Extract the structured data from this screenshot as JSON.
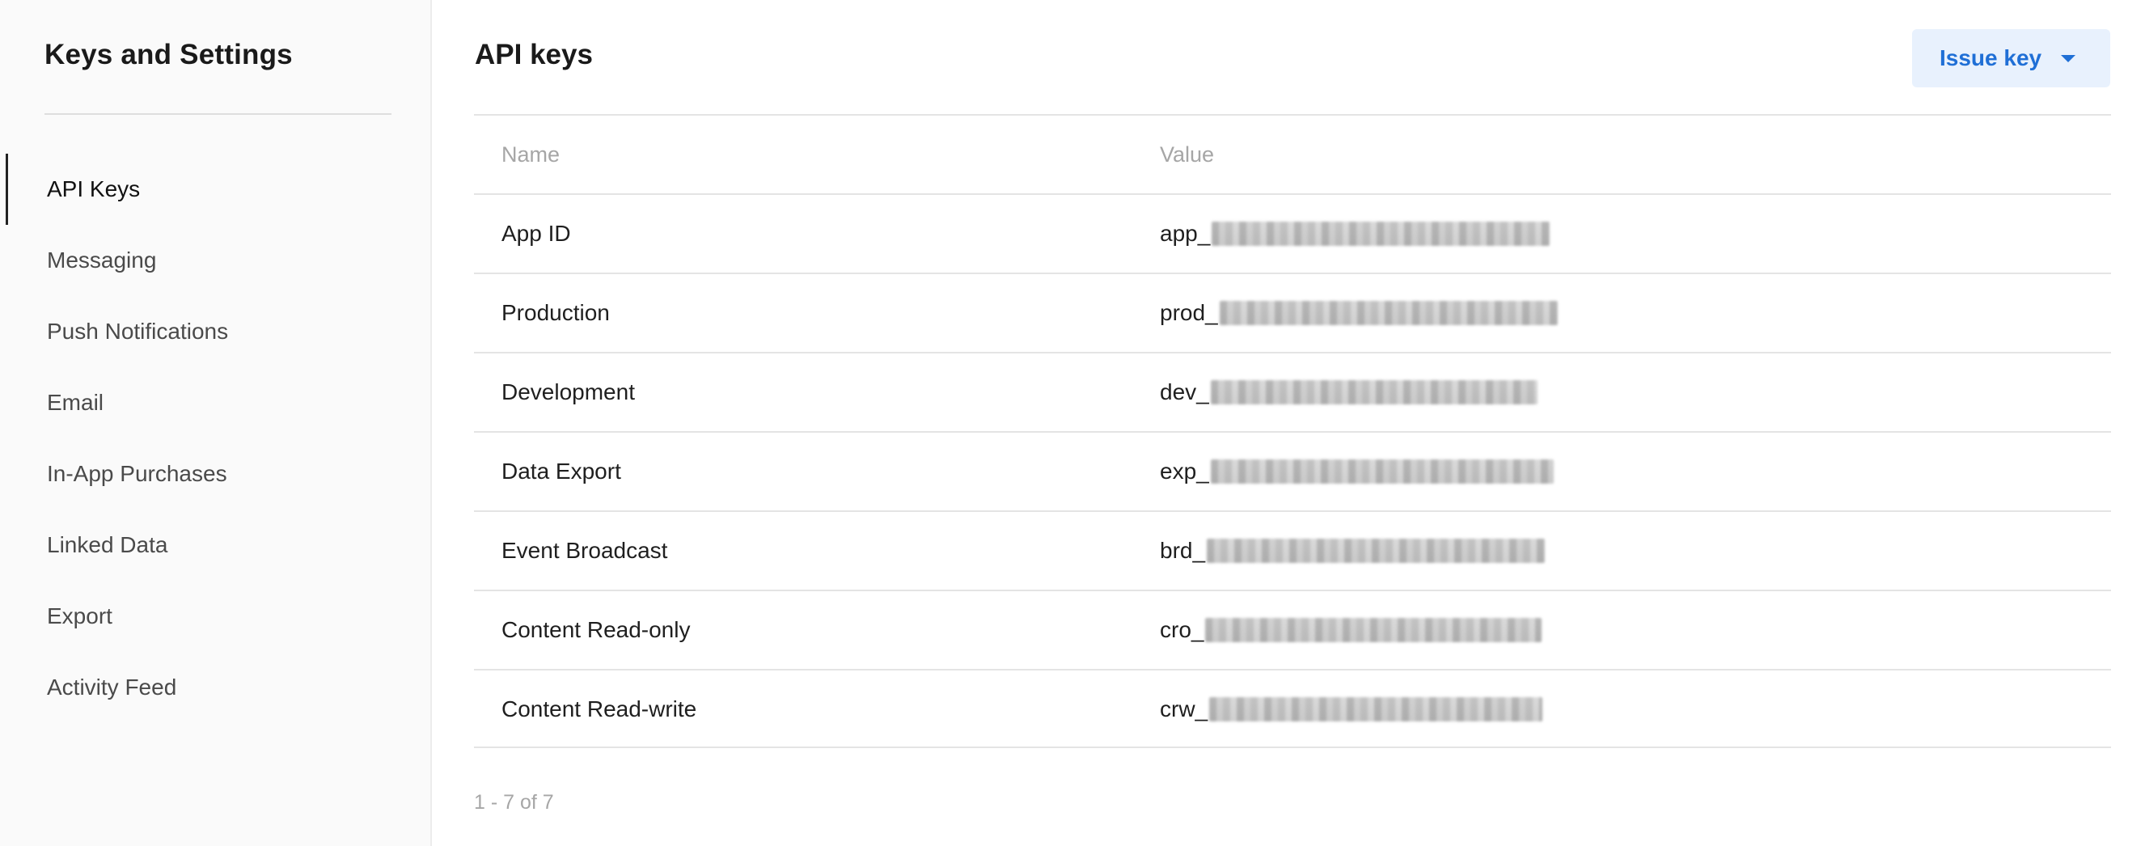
{
  "sidebar": {
    "title": "Keys and Settings",
    "items": [
      {
        "label": "API Keys",
        "active": true
      },
      {
        "label": "Messaging",
        "active": false
      },
      {
        "label": "Push Notifications",
        "active": false
      },
      {
        "label": "Email",
        "active": false
      },
      {
        "label": "In-App Purchases",
        "active": false
      },
      {
        "label": "Linked Data",
        "active": false
      },
      {
        "label": "Export",
        "active": false
      },
      {
        "label": "Activity Feed",
        "active": false
      }
    ]
  },
  "main": {
    "title": "API keys",
    "issue_button_label": "Issue key",
    "accent_color": "#1f6fd6",
    "table": {
      "headers": {
        "name": "Name",
        "value": "Value"
      },
      "rows": [
        {
          "name": "App ID",
          "prefix": "app_"
        },
        {
          "name": "Production",
          "prefix": "prod_"
        },
        {
          "name": "Development",
          "prefix": "dev_"
        },
        {
          "name": "Data Export",
          "prefix": "exp_"
        },
        {
          "name": "Event Broadcast",
          "prefix": "brd_"
        },
        {
          "name": "Content Read-only",
          "prefix": "cro_"
        },
        {
          "name": "Content Read-write",
          "prefix": "crw_"
        }
      ]
    },
    "pagination": "1 - 7 of 7"
  }
}
